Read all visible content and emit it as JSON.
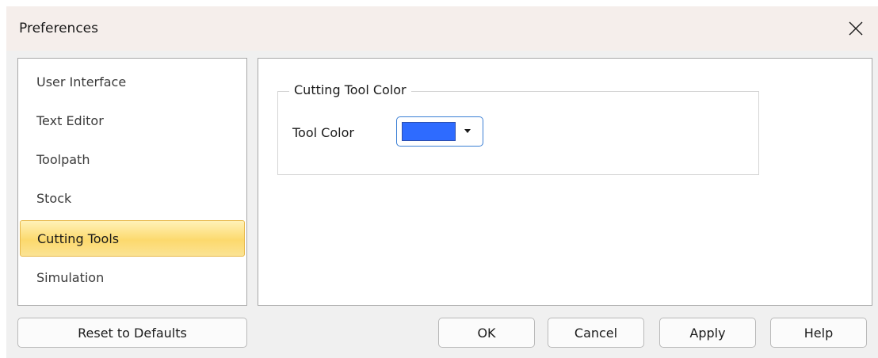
{
  "window": {
    "title": "Preferences",
    "close_icon": "close-icon"
  },
  "nav": {
    "items": [
      {
        "label": "User Interface",
        "selected": false
      },
      {
        "label": "Text Editor",
        "selected": false
      },
      {
        "label": "Toolpath",
        "selected": false
      },
      {
        "label": "Stock",
        "selected": false
      },
      {
        "label": "Cutting Tools",
        "selected": true
      },
      {
        "label": "Simulation",
        "selected": false
      }
    ]
  },
  "content": {
    "group_title": "Cutting Tool Color",
    "field_label": "Tool Color",
    "tool_color": "#2e6bff",
    "dropdown_icon": "chevron-down-icon"
  },
  "buttons": {
    "reset": "Reset to Defaults",
    "ok": "OK",
    "cancel": "Cancel",
    "apply": "Apply",
    "help": "Help"
  },
  "colors": {
    "selection_fill": "#fcd96d",
    "selection_border": "#e8b94a",
    "focus_border": "#3b7fd4"
  }
}
